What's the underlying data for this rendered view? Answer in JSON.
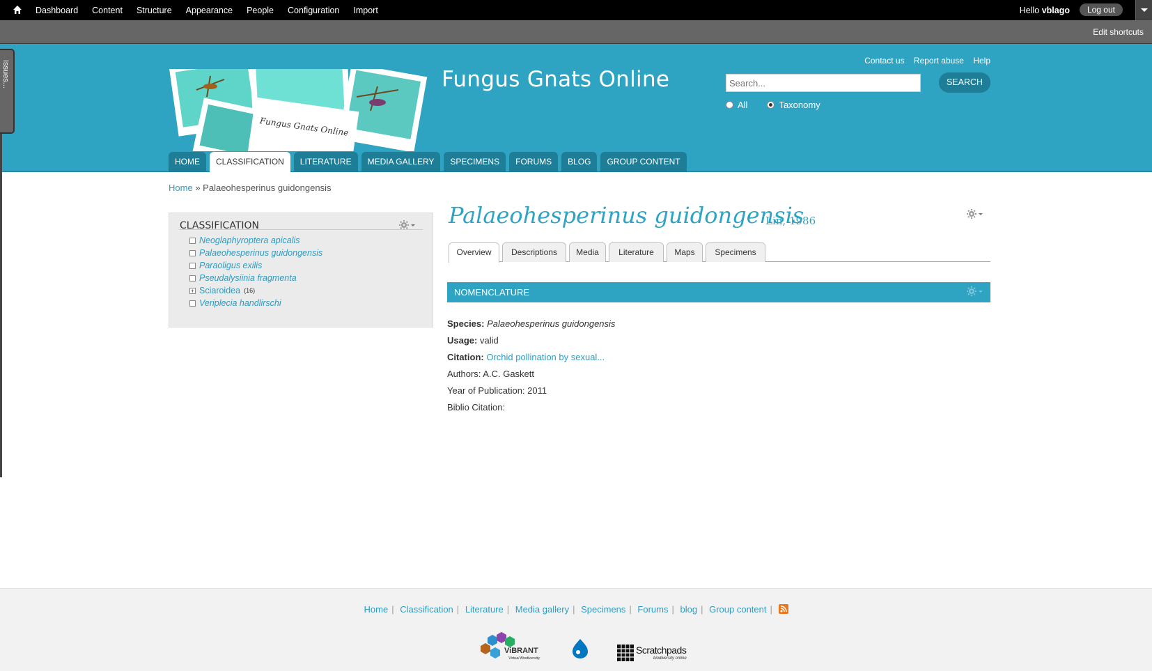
{
  "toolbar": {
    "menu": [
      "Dashboard",
      "Content",
      "Structure",
      "Appearance",
      "People",
      "Configuration",
      "Import"
    ],
    "hello": "Hello",
    "username": "vblago",
    "logout": "Log out",
    "shortcuts": "Edit shortcuts"
  },
  "issues_tab": "Issues...",
  "header": {
    "site_name": "Fungus Gnats Online",
    "logo_caption": "Fungus Gnats Online",
    "links": [
      "Contact us",
      "Report abuse",
      "Help"
    ],
    "search": {
      "placeholder": "Search...",
      "button": "SEARCH",
      "options": [
        "All",
        "Taxonomy"
      ],
      "selected": "Taxonomy"
    },
    "nav": [
      "HOME",
      "CLASSIFICATION",
      "LITERATURE",
      "MEDIA GALLERY",
      "SPECIMENS",
      "FORUMS",
      "BLOG",
      "GROUP CONTENT"
    ],
    "nav_active": "CLASSIFICATION"
  },
  "breadcrumb": {
    "home": "Home",
    "separator": "»",
    "current": "Palaeohesperinus guidongensis"
  },
  "sidebar": {
    "title": "CLASSIFICATION",
    "tree": [
      {
        "label": "Neoglaphyroptera apicalis",
        "italic": true
      },
      {
        "label": "Palaeohesperinus guidongensis",
        "italic": true
      },
      {
        "label": "Paraoligus exilis",
        "italic": true
      },
      {
        "label": "Pseudalysiinia fragmenta",
        "italic": true
      },
      {
        "label": "Sciaroidea",
        "italic": false,
        "count": "(16)",
        "expandable": true
      },
      {
        "label": "Veriplecia handlirschi",
        "italic": true
      }
    ]
  },
  "main": {
    "title": "Palaeohesperinus guidongensis",
    "author": "Lin, 1986",
    "tabs": [
      "Overview",
      "Descriptions",
      "Media",
      "Literature",
      "Maps",
      "Specimens"
    ],
    "active_tab": "Overview",
    "section_title": "NOMENCLATURE",
    "fields": {
      "species_label": "Species:",
      "species_value": "Palaeohesperinus guidongensis",
      "usage_label": "Usage:",
      "usage_value": "valid",
      "citation_label": "Citation:",
      "citation_value": "Orchid pollination by sexual...",
      "authors": "Authors: A.C. Gaskett",
      "year": "Year of Publication: 2011",
      "biblio": "Biblio Citation:"
    }
  },
  "footer": {
    "links": [
      "Home",
      "Classification",
      "Literature",
      "Media gallery",
      "Specimens",
      "Forums",
      "blog",
      "Group content"
    ],
    "logos": {
      "vibrant": "ViBRANT",
      "vibrant_sub": "Virtual Biodiversity",
      "scratchpads": "Scratchpads",
      "scratchpads_sub": "biodiversity online"
    }
  },
  "colors": {
    "header_bg": "#2ea4c2",
    "nav_bg": "#1e7e98",
    "link": "#2e9bbf",
    "toolbar_bg": "#000000"
  }
}
